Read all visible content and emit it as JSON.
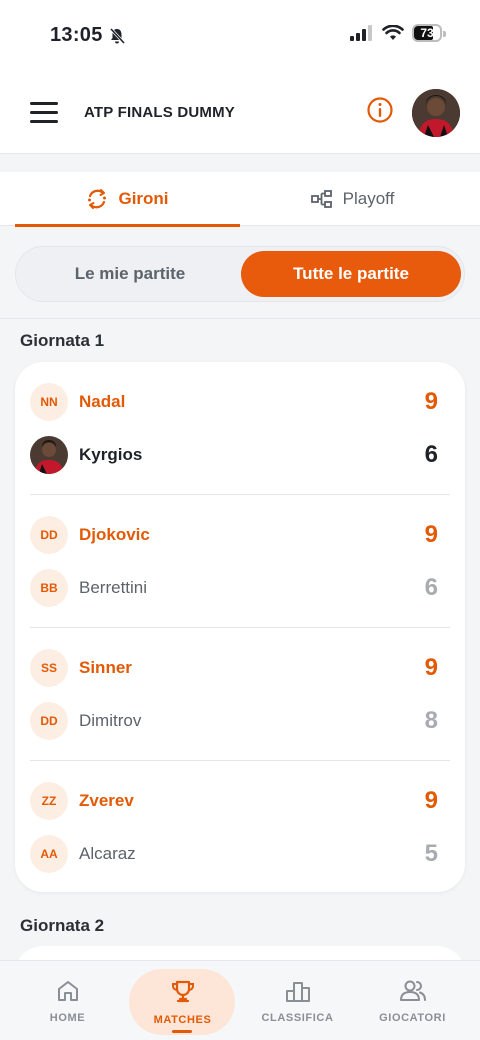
{
  "status_bar": {
    "time": "13:05",
    "battery": "73"
  },
  "header": {
    "title": "ATP FINALS DUMMY"
  },
  "tabs": [
    {
      "label": "Gironi",
      "icon": "rotate-icon"
    },
    {
      "label": "Playoff",
      "icon": "bracket-icon"
    }
  ],
  "segment": {
    "mine": "Le mie partite",
    "all": "Tutte le partite"
  },
  "rounds": [
    {
      "title": "Giornata 1",
      "matches": [
        {
          "p1": {
            "initials": "NN",
            "name": "Nadal",
            "score": "9"
          },
          "p2": {
            "initials": "",
            "name": "Kyrgios",
            "score": "6"
          }
        },
        {
          "p1": {
            "initials": "DD",
            "name": "Djokovic",
            "score": "9"
          },
          "p2": {
            "initials": "BB",
            "name": "Berrettini",
            "score": "6"
          }
        },
        {
          "p1": {
            "initials": "SS",
            "name": "Sinner",
            "score": "9"
          },
          "p2": {
            "initials": "DD",
            "name": "Dimitrov",
            "score": "8"
          }
        },
        {
          "p1": {
            "initials": "ZZ",
            "name": "Zverev",
            "score": "9"
          },
          "p2": {
            "initials": "AA",
            "name": "Alcaraz",
            "score": "5"
          }
        }
      ]
    },
    {
      "title": "Giornata 2",
      "matches": []
    }
  ],
  "bottom_nav": [
    {
      "label": "HOME",
      "icon": "home-icon"
    },
    {
      "label": "MATCHES",
      "icon": "trophy-icon"
    },
    {
      "label": "CLASSIFICA",
      "icon": "podium-icon"
    },
    {
      "label": "GIOCATORI",
      "icon": "users-icon"
    }
  ],
  "colors": {
    "accent": "#e25a06",
    "accent_soft": "#fdeee4",
    "muted": "#5d636b",
    "score_muted": "#a8acb1"
  }
}
